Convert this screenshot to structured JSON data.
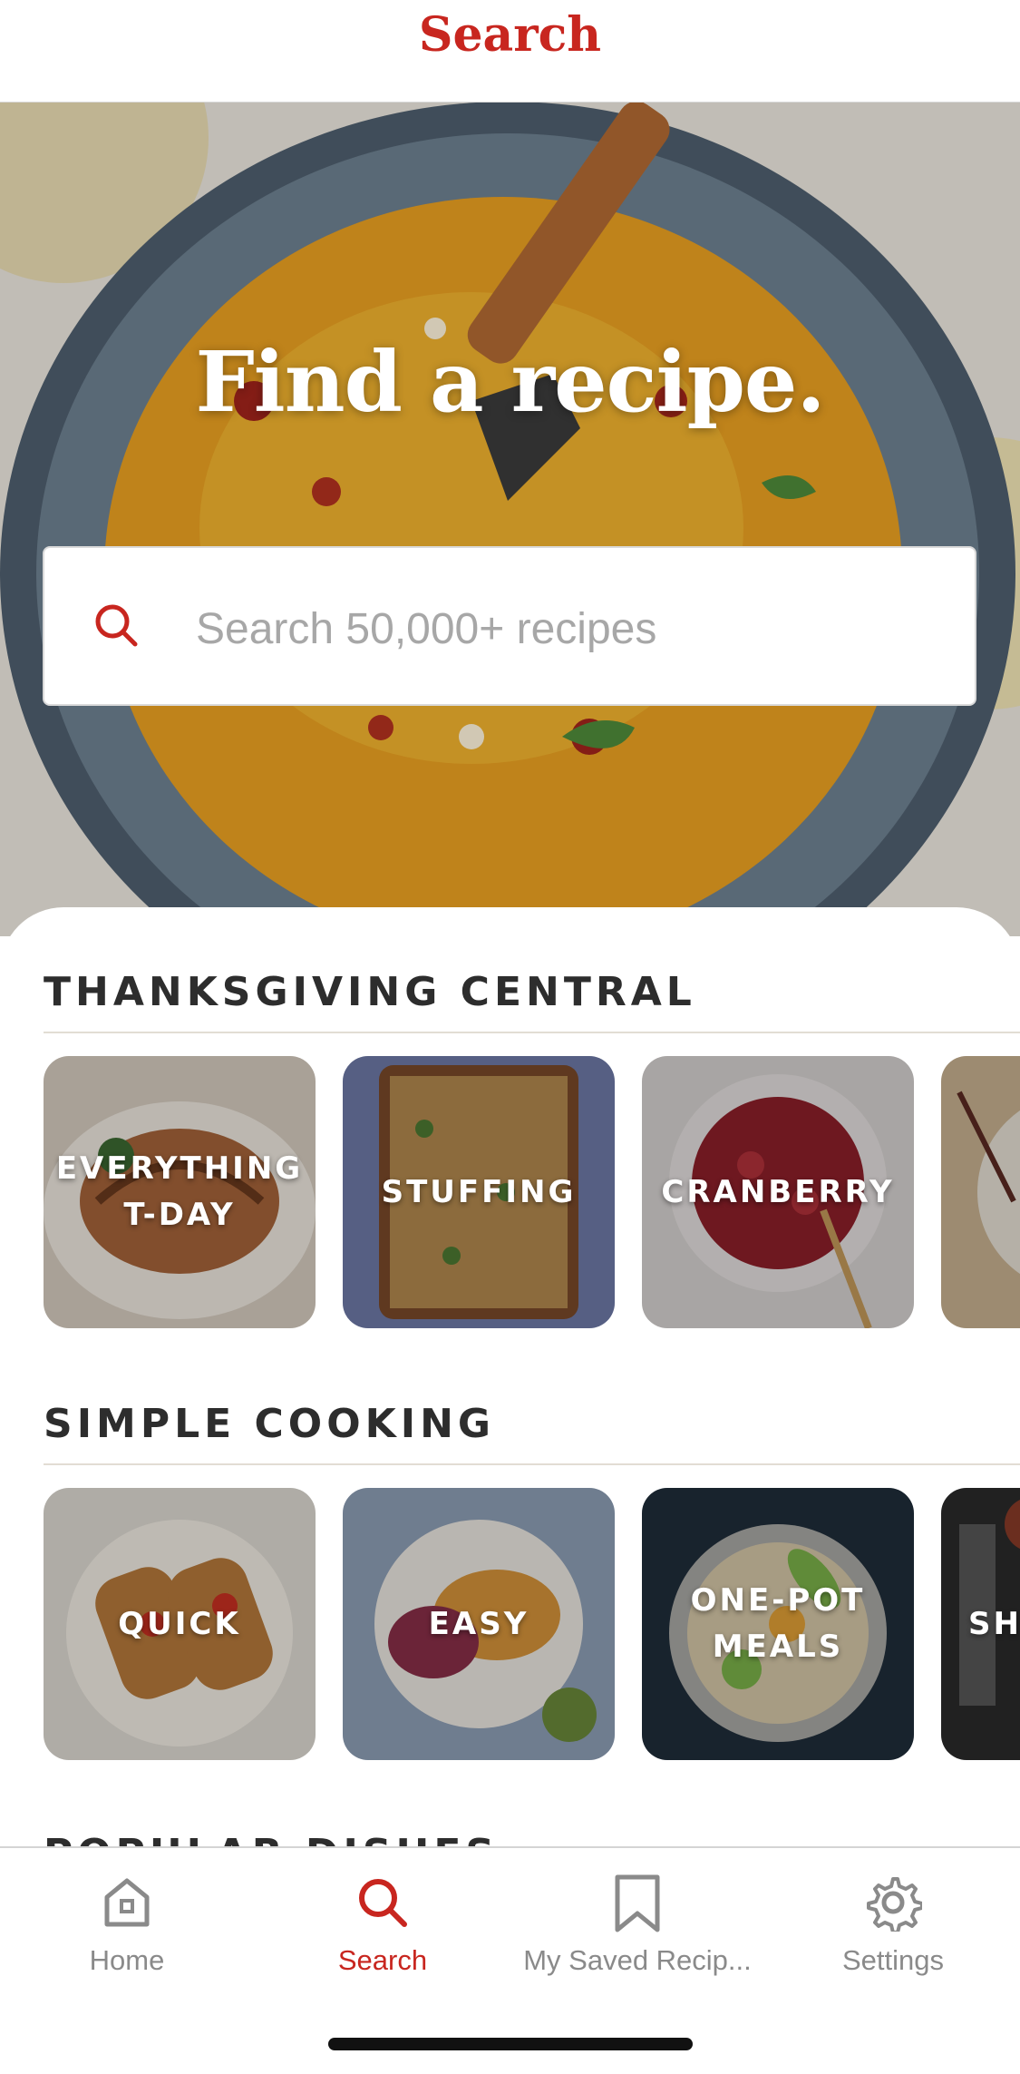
{
  "header": {
    "title": "Search"
  },
  "hero": {
    "title": "Find a recipe.",
    "search_placeholder": "Search 50,000+ recipes",
    "search_icon": "search-icon"
  },
  "sections": [
    {
      "title": "THANKSGIVING CENTRAL",
      "tiles": [
        {
          "label": "EVERYTHING T-DAY"
        },
        {
          "label": "STUFFING"
        },
        {
          "label": "CRANBERRY"
        },
        {
          "label": ""
        }
      ]
    },
    {
      "title": "SIMPLE COOKING",
      "tiles": [
        {
          "label": "QUICK"
        },
        {
          "label": "EASY"
        },
        {
          "label": "ONE-POT MEALS"
        },
        {
          "label": "SH D"
        }
      ]
    },
    {
      "title": "POPULAR DISHES"
    }
  ],
  "tabbar": {
    "items": [
      {
        "label": "Home",
        "icon": "home-icon",
        "active": false
      },
      {
        "label": "Search",
        "icon": "search-icon",
        "active": true
      },
      {
        "label": "My Saved Recip...",
        "icon": "bookmark-icon",
        "active": false
      },
      {
        "label": "Settings",
        "icon": "gear-icon",
        "active": false
      }
    ]
  },
  "colors": {
    "accent": "#c8261f",
    "text": "#2d2d2d",
    "muted": "#8a8a8a"
  }
}
